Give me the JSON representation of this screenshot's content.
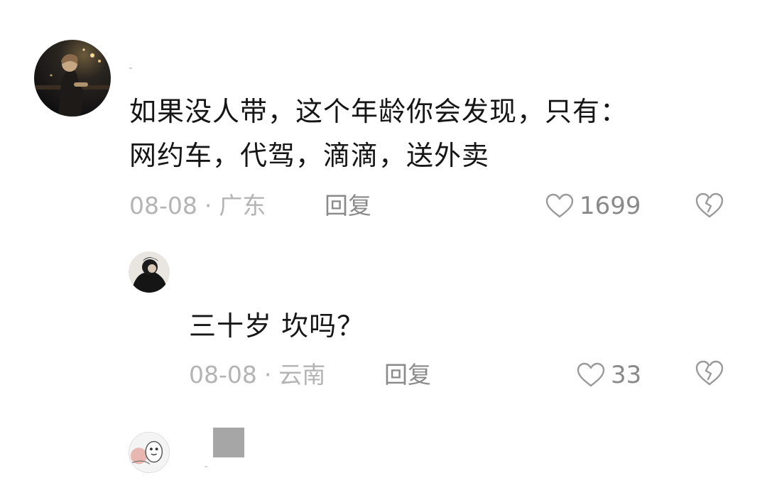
{
  "comments": [
    {
      "text_lines": [
        "如果没人带，这个年龄你会发现，只有：",
        "网约车，代驾，滴滴，送外卖"
      ],
      "date": "08-08",
      "separator": "·",
      "location": "广东",
      "reply_label": "回复",
      "likes": "1699"
    },
    {
      "text_lines": [
        "三十岁 坎吗？"
      ],
      "date": "08-08",
      "separator": "·",
      "location": "云南",
      "reply_label": "回复",
      "likes": "33"
    }
  ],
  "icons": {
    "like": "heart-outline-icon",
    "dislike": "broken-heart-icon"
  },
  "colors": {
    "meta_grey": "#b4b4b4",
    "action_grey": "#8a8a8a",
    "text": "#161616"
  }
}
